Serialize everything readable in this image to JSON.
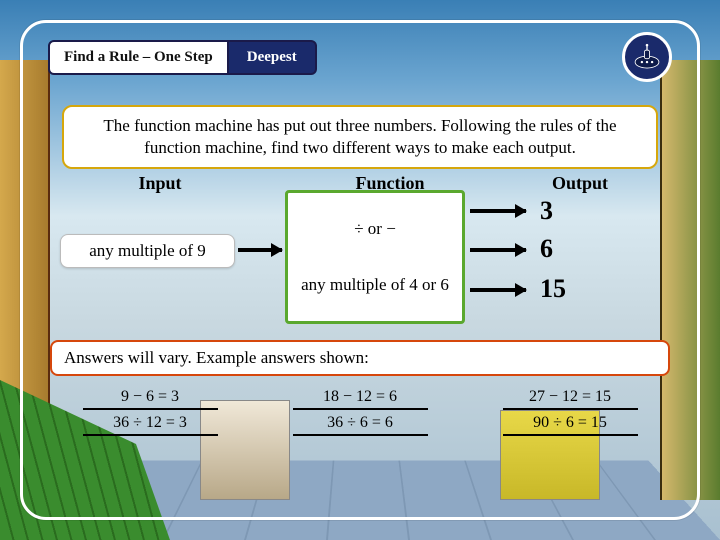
{
  "header": {
    "title": "Find a Rule – One Step",
    "level": "Deepest"
  },
  "prompt": "The function machine has put out three numbers. Following the rules of the function machine, find two different ways to make each output.",
  "labels": {
    "input": "Input",
    "function": "Function",
    "output": "Output"
  },
  "machine": {
    "input_constraint": "any multiple of 9",
    "func_op": "÷ or −",
    "func_constraint": "any multiple of 4 or 6",
    "outputs": [
      "3",
      "6",
      "15"
    ]
  },
  "answers_label": "Answers will vary. Example answers shown:",
  "examples": [
    {
      "line1": "9 − 6 = 3",
      "line2": "36 ÷ 12 = 3"
    },
    {
      "line1": "18 − 12 = 6",
      "line2": "36 ÷ 6  = 6"
    },
    {
      "line1": "27 − 12 = 15",
      "line2": "90 ÷ 6  = 15"
    }
  ],
  "icon": "submarine-icon"
}
